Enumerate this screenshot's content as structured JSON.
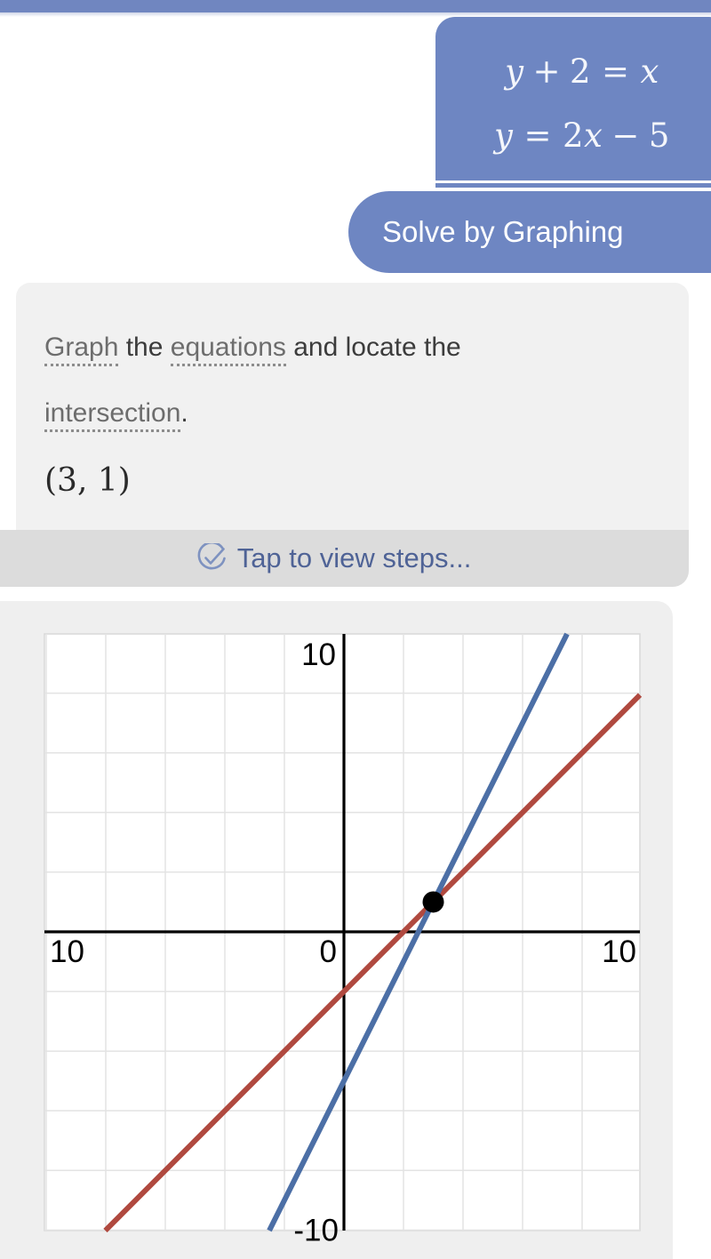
{
  "app": {
    "status_bar_color": "#7086c0",
    "accent_color": "#6e86c2",
    "card_bg": "#f1f1f1",
    "steps_bar_bg": "#dcdcdc",
    "graph_card_bg": "#efefef"
  },
  "question_bubble": {
    "equation_1": "y + 2 = x",
    "equation_2": "y = 2x − 5",
    "eq1_parts": {
      "lhs_var": "y",
      "plus": "+",
      "const": "2",
      "eq": "=",
      "rhs_var": "x"
    },
    "eq2_parts": {
      "lhs_var": "y",
      "eq": "=",
      "coef": "2",
      "var": "x",
      "minus": "−",
      "const": "5"
    }
  },
  "action_bubble": {
    "label": "Solve by Graphing"
  },
  "answer_card": {
    "line1_word1": "Graph",
    "line1_word2": " the ",
    "line1_word3": "equations",
    "line1_word4": " and locate the",
    "line2_word1": "intersection",
    "line2_period": ".",
    "answer": "(3, 1)"
  },
  "steps_bar": {
    "icon": "check-circle-icon",
    "label": "Tap to view steps...",
    "text_color": "#4f6396"
  },
  "chart_data": {
    "type": "line",
    "title": "",
    "xlabel": "",
    "ylabel": "",
    "xlim": [
      -10,
      10
    ],
    "ylim": [
      -10,
      10
    ],
    "grid": true,
    "grid_step": 2,
    "legend": "none",
    "x_tick_labels": [
      "10",
      "0",
      "10"
    ],
    "y_tick_labels": [
      "10",
      "-10"
    ],
    "axis_label_left": "10",
    "axis_label_origin": "0",
    "axis_label_right": "10",
    "axis_label_top": "10",
    "axis_label_bottom": "-10",
    "series": [
      {
        "name": "y = x - 2",
        "equation_source": "y + 2 = x",
        "color": "#b0493f",
        "slope": 1,
        "intercept": -2,
        "points": [
          [
            -10,
            -12
          ],
          [
            10,
            8
          ]
        ]
      },
      {
        "name": "y = 2x - 5",
        "equation_source": "y = 2x - 5",
        "color": "#4c6fa6",
        "slope": 2,
        "intercept": -5,
        "points": [
          [
            -3,
            -11
          ],
          [
            7.5,
            10
          ]
        ]
      }
    ],
    "annotations": [
      {
        "type": "point",
        "name": "intersection",
        "x": 3,
        "y": 1,
        "color": "#000000",
        "label": "(3, 1)"
      }
    ]
  }
}
